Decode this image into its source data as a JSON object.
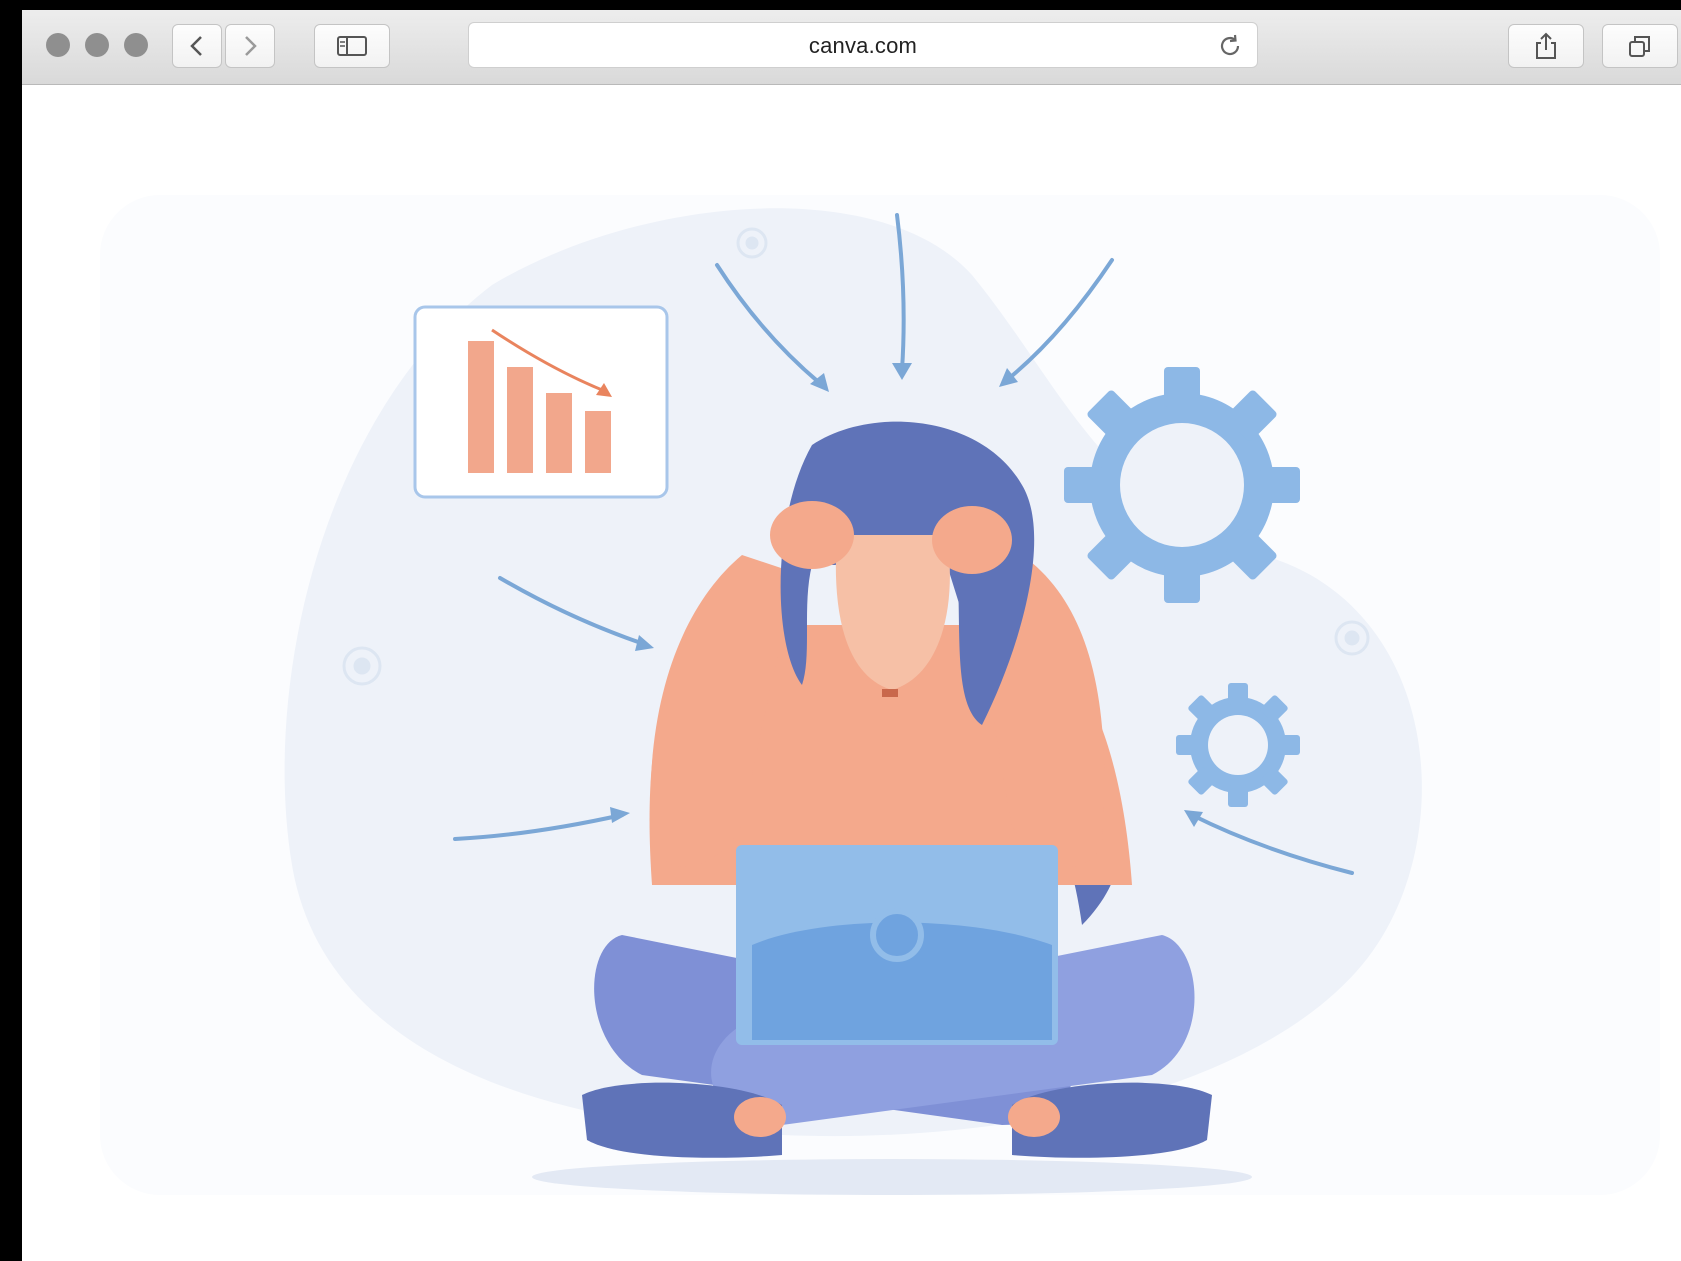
{
  "browser": {
    "url": "canva.com",
    "icons": {
      "back": "chevron-left-icon",
      "forward": "chevron-right-icon",
      "sidebar": "sidebar-icon",
      "reload": "reload-icon",
      "share": "share-icon",
      "tabs": "tabs-icon"
    }
  },
  "illustration": {
    "subject": "stressed-person-with-laptop-icon",
    "chart_icon": "declining-bar-chart-icon",
    "gear_icon": "gear-icon",
    "colors": {
      "skin": "#F4A98C",
      "hair": "#5F73B8",
      "pants": "#7F90D6",
      "laptop": "#6FA3DF",
      "arrows": "#7BA7D6",
      "bars": "#F2A78C",
      "blob": "#EEF2F9"
    }
  }
}
